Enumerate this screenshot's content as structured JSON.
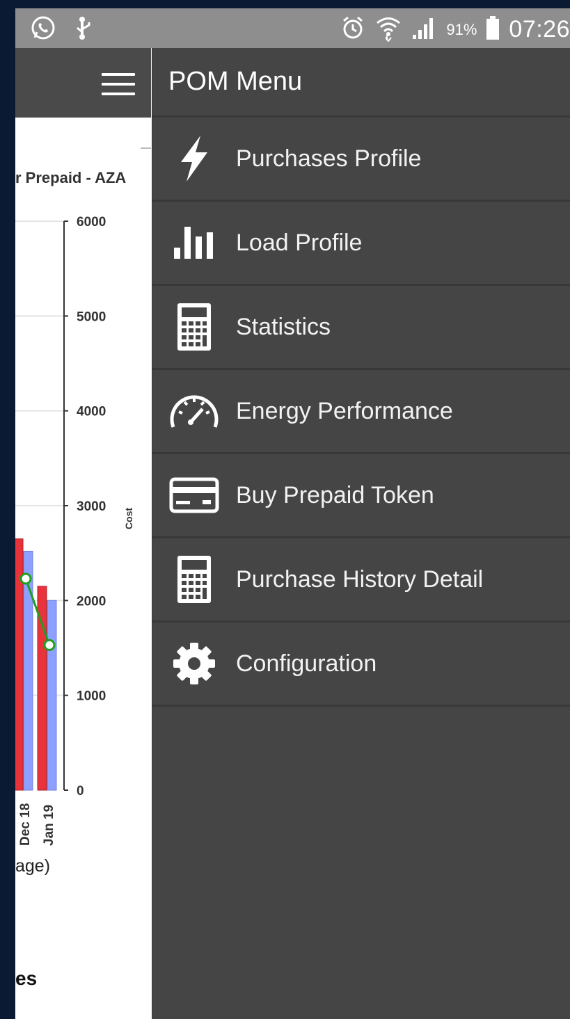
{
  "status_bar": {
    "battery_percent": "91%",
    "time": "07:26",
    "icons": [
      "whatsapp-icon",
      "usb-debug-icon",
      "alarm-icon",
      "wifi-icon",
      "signal-icon",
      "battery-icon"
    ]
  },
  "drawer": {
    "title": "POM Menu",
    "items": [
      {
        "label": "Purchases Profile",
        "icon": "lightning-icon"
      },
      {
        "label": "Load Profile",
        "icon": "bar-chart-icon"
      },
      {
        "label": "Statistics",
        "icon": "calculator-icon"
      },
      {
        "label": "Energy Performance",
        "icon": "speedometer-icon"
      },
      {
        "label": "Buy Prepaid Token",
        "icon": "credit-card-icon"
      },
      {
        "label": "Purchase History Detail",
        "icon": "calculator-icon"
      },
      {
        "label": "Configuration",
        "icon": "gear-icon"
      }
    ]
  },
  "background": {
    "chart_title_fragment": "r Prepaid - AZA",
    "x_caption_fragment": "age)",
    "section_title_fragment": "es",
    "colors": {
      "red_series": "#e8333a",
      "blue_series": "#8ea0ff",
      "line_series": "#1f9e1f"
    }
  },
  "chart_data": {
    "type": "bar",
    "title": "r Prepaid - AZA",
    "categories": [
      "Dec 18",
      "Jan 19"
    ],
    "x_tick_labels": [
      "Dec 18",
      "Jan 19"
    ],
    "ylabel": "Cost",
    "yticks": [
      0,
      1000,
      2000,
      3000,
      4000,
      5000,
      6000
    ],
    "ylim": [
      0,
      6000
    ],
    "series": [
      {
        "color": "#e8333a",
        "values": [
          2650,
          2150
        ]
      },
      {
        "color": "#8ea0ff",
        "values": [
          2520,
          2000
        ]
      },
      {
        "color": "#1f9e1f",
        "type": "line",
        "values": [
          2230,
          1530
        ]
      }
    ],
    "grid": true
  }
}
